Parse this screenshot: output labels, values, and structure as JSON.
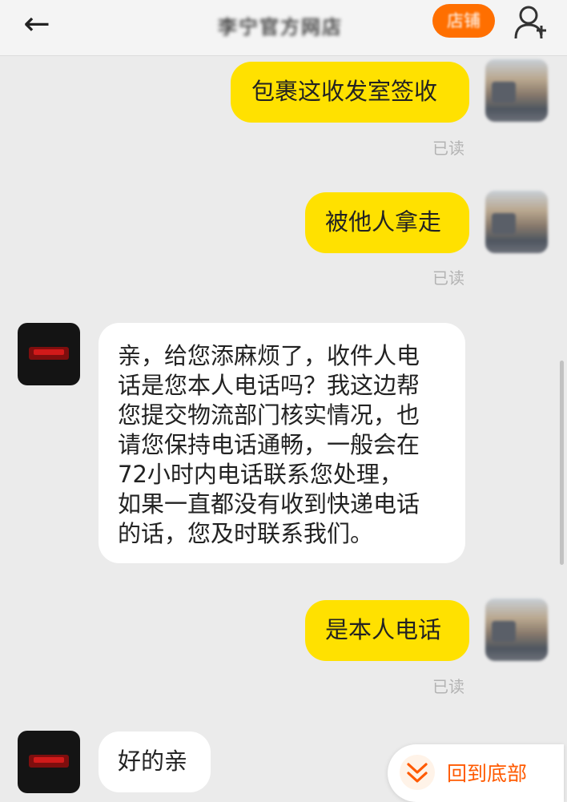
{
  "header": {
    "back_icon": "←",
    "shop_name": "李宁官方网店",
    "shop_button": "店铺",
    "user_icon": "user-icon"
  },
  "messages": [
    {
      "from": "me",
      "text": "包裹这收发室签收",
      "status": "已读"
    },
    {
      "from": "me",
      "text": "被他人拿走",
      "status": "已读"
    },
    {
      "from": "shop",
      "text": "亲，给您添麻烦了，收件人电\n话是您本人电话吗？我这边帮\n您提交物流部门核实情况，也\n请您保持电话通畅，一般会在\n72小时内电话联系您处理，\n如果一直都没有收到快递电话\n的话，您及时联系我们。"
    },
    {
      "from": "me",
      "text": "是本人电话",
      "status": "已读"
    },
    {
      "from": "shop",
      "text": "好的亲"
    }
  ],
  "back_to_bottom": {
    "label": "回到底部",
    "icon": "double-chevron-down-icon"
  },
  "colors": {
    "accent": "#ff6f00",
    "outgoing_bubble": "#ffe100",
    "incoming_bubble": "#ffffff",
    "read_status": "#b3b3b3"
  }
}
